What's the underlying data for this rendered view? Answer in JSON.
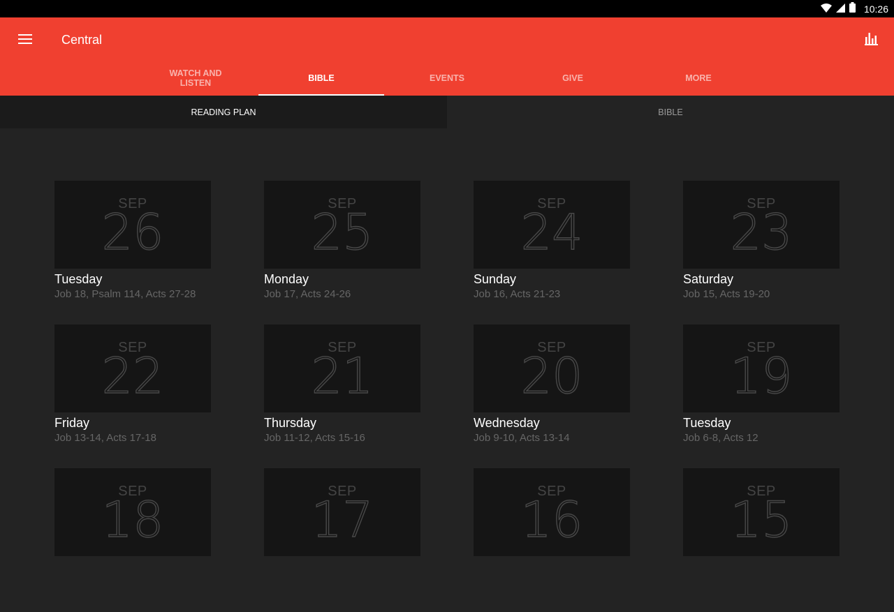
{
  "status": {
    "time": "10:26"
  },
  "header": {
    "title": "Central"
  },
  "tabs": [
    {
      "label": "WATCH AND LISTEN"
    },
    {
      "label": "BIBLE"
    },
    {
      "label": "EVENTS"
    },
    {
      "label": "GIVE"
    },
    {
      "label": "MORE"
    }
  ],
  "subtabs": [
    {
      "label": "READING PLAN"
    },
    {
      "label": "BIBLE"
    }
  ],
  "days": [
    {
      "month": "SEP",
      "day": "26",
      "weekday": "Tuesday",
      "readings": "Job 18, Psalm 114, Acts 27-28"
    },
    {
      "month": "SEP",
      "day": "25",
      "weekday": "Monday",
      "readings": "Job 17, Acts 24-26"
    },
    {
      "month": "SEP",
      "day": "24",
      "weekday": "Sunday",
      "readings": "Job 16, Acts 21-23"
    },
    {
      "month": "SEP",
      "day": "23",
      "weekday": "Saturday",
      "readings": "Job 15, Acts 19-20"
    },
    {
      "month": "SEP",
      "day": "22",
      "weekday": "Friday",
      "readings": "Job 13-14, Acts 17-18"
    },
    {
      "month": "SEP",
      "day": "21",
      "weekday": "Thursday",
      "readings": "Job 11-12, Acts 15-16"
    },
    {
      "month": "SEP",
      "day": "20",
      "weekday": "Wednesday",
      "readings": "Job 9-10, Acts 13-14"
    },
    {
      "month": "SEP",
      "day": "19",
      "weekday": "Tuesday",
      "readings": "Job 6-8, Acts 12"
    },
    {
      "month": "SEP",
      "day": "18",
      "weekday": "",
      "readings": ""
    },
    {
      "month": "SEP",
      "day": "17",
      "weekday": "",
      "readings": ""
    },
    {
      "month": "SEP",
      "day": "16",
      "weekday": "",
      "readings": ""
    },
    {
      "month": "SEP",
      "day": "15",
      "weekday": "",
      "readings": ""
    }
  ],
  "colors": {
    "accent": "#f04030",
    "background": "#232323",
    "tile": "#151515"
  },
  "icons": {
    "menu": "hamburger-menu-icon",
    "chart": "bar-chart-icon",
    "wifi": "wifi-icon",
    "signal": "signal-icon",
    "battery": "battery-icon"
  }
}
